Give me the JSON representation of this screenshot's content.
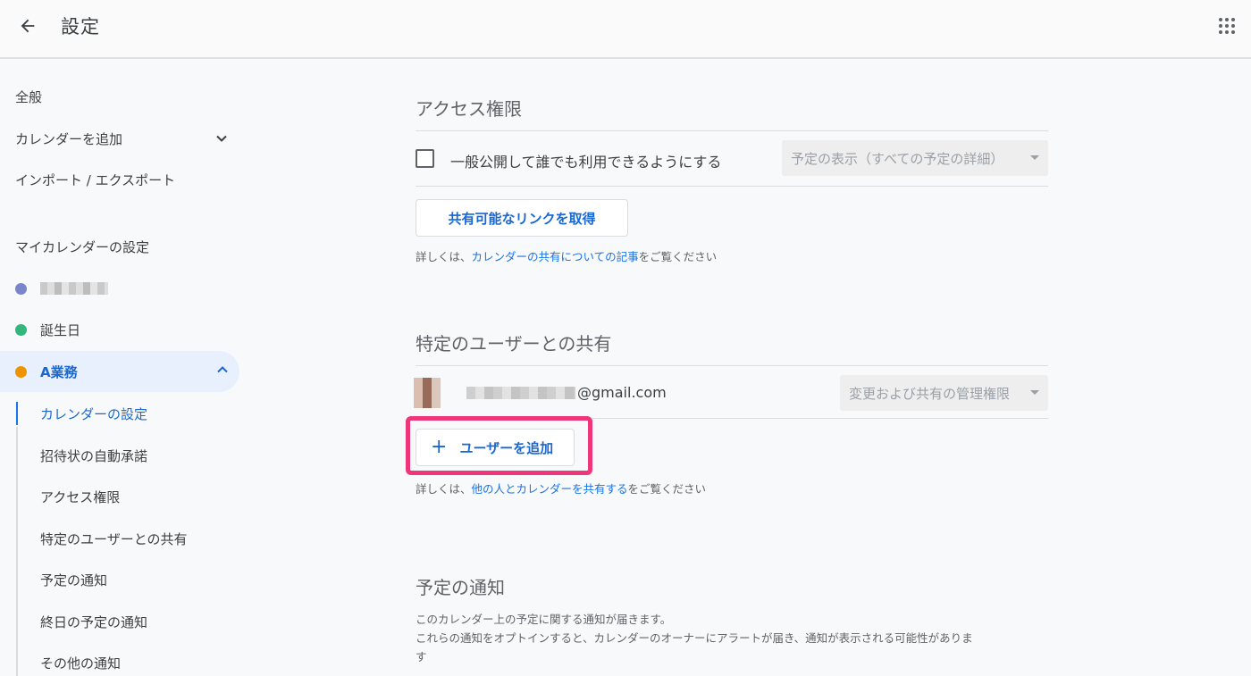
{
  "header": {
    "back_icon": "arrow-left-icon",
    "title": "設定",
    "apps_icon": "grid-apps-icon"
  },
  "sidebar": {
    "general": "全般",
    "add_calendar": "カレンダーを追加",
    "import_export": "インポート / エクスポート",
    "my_calendars_heading": "マイカレンダーの設定",
    "calendars": [
      {
        "label": "",
        "color": "#7986cb",
        "blurred": true
      },
      {
        "label": "誕生日",
        "color": "#33b679"
      },
      {
        "label": "A業務",
        "color": "#f09300",
        "active": true
      }
    ],
    "sub_items": [
      {
        "label": "カレンダーの設定",
        "active": true
      },
      {
        "label": "招待状の自動承諾"
      },
      {
        "label": "アクセス権限"
      },
      {
        "label": "特定のユーザーとの共有"
      },
      {
        "label": "予定の通知"
      },
      {
        "label": "終日の予定の通知"
      },
      {
        "label": "その他の通知"
      }
    ]
  },
  "access": {
    "title": "アクセス権限",
    "public_label": "一般公開して誰でも利用できるようにする",
    "public_checked": false,
    "visibility_select": "予定の表示（すべての予定の詳細）",
    "share_link_button": "共有可能なリンクを取得",
    "help_prefix": "詳しくは、",
    "help_link": "カレンダーの共有についての記事",
    "help_suffix": "をご覧ください"
  },
  "sharing": {
    "title": "特定のユーザーとの共有",
    "user_email_visible": "@gmail.com",
    "permission_select": "変更および共有の管理権限",
    "add_user_button": "ユーザーを追加",
    "add_user_icon": "plus-icon",
    "help_prefix": "詳しくは、",
    "help_link": "他の人とカレンダーを共有する",
    "help_suffix": "をご覧ください",
    "highlight_color": "#f0367a"
  },
  "notifications": {
    "title": "予定の通知",
    "line1": "このカレンダー上の予定に関する通知が届きます。",
    "line2": "これらの通知をオプトインすると、カレンダーのオーナーにアラートが届き、通知が表示される可能性がありま",
    "line3": "す"
  },
  "colors": {
    "accent": "#1a73e8",
    "active_bg": "#e8f0fe"
  }
}
